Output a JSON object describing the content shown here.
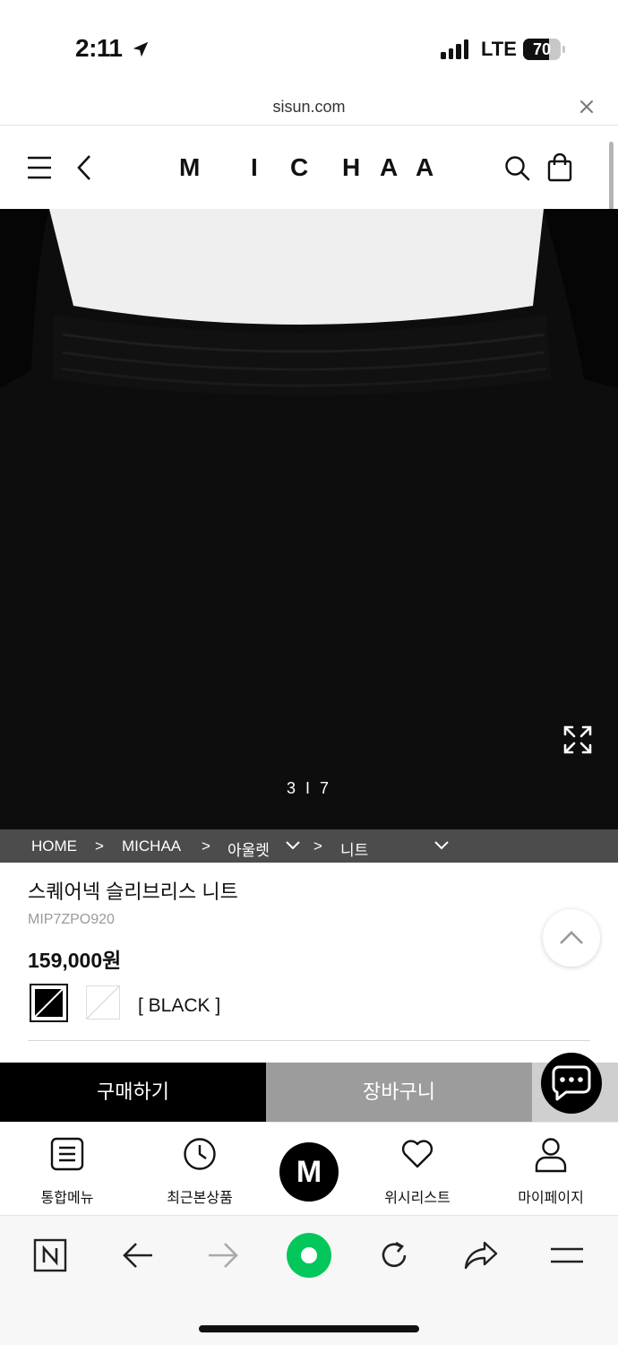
{
  "status_bar": {
    "time": "2:11",
    "network": "LTE",
    "battery": "70",
    "battery_level": 0.7
  },
  "browser": {
    "url": "sisun.com"
  },
  "header": {
    "logo_letters": [
      "M",
      "I",
      "C",
      "H",
      "A",
      "A"
    ]
  },
  "hero": {
    "image_counter": "3 I 7"
  },
  "breadcrumb": {
    "items": [
      "HOME",
      "MICHAA",
      "아울렛",
      "니트"
    ],
    "separator": ">"
  },
  "product": {
    "title": "스퀘어넥 슬리브리스 니트",
    "code": "MIP7ZPO920",
    "price": "159,000원",
    "color_label": "[ BLACK ]"
  },
  "actions": {
    "buy": "구매하기",
    "cart": "장바구니"
  },
  "bottom_nav": {
    "menu": "통합메뉴",
    "recent": "최근본상품",
    "home": "M",
    "wishlist": "위시리스트",
    "mypage": "마이페이지"
  },
  "colors": {
    "accent": "#000000",
    "cart_gray": "#9c9c9c",
    "naver_green": "#03c75a",
    "breadcrumb_bg": "#5f5f5f"
  }
}
